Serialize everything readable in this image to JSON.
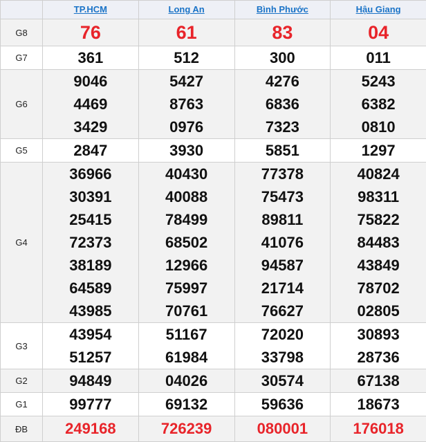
{
  "provinces": [
    "TP.HCM",
    "Long An",
    "Bình Phước",
    "Hậu Giang"
  ],
  "prizes": [
    {
      "label": "G8",
      "key": "g8",
      "style": "red",
      "results": [
        [
          "76"
        ],
        [
          "61"
        ],
        [
          "83"
        ],
        [
          "04"
        ]
      ]
    },
    {
      "label": "G7",
      "key": "g7",
      "style": "normal",
      "results": [
        [
          "361"
        ],
        [
          "512"
        ],
        [
          "300"
        ],
        [
          "011"
        ]
      ]
    },
    {
      "label": "G6",
      "key": "g6",
      "style": "normal",
      "results": [
        [
          "9046",
          "4469",
          "3429"
        ],
        [
          "5427",
          "8763",
          "0976"
        ],
        [
          "4276",
          "6836",
          "7323"
        ],
        [
          "5243",
          "6382",
          "0810"
        ]
      ]
    },
    {
      "label": "G5",
      "key": "g5",
      "style": "normal",
      "results": [
        [
          "2847"
        ],
        [
          "3930"
        ],
        [
          "5851"
        ],
        [
          "1297"
        ]
      ]
    },
    {
      "label": "G4",
      "key": "g4",
      "style": "normal",
      "results": [
        [
          "36966",
          "30391",
          "25415",
          "72373",
          "38189",
          "64589",
          "43985"
        ],
        [
          "40430",
          "40088",
          "78499",
          "68502",
          "12966",
          "75997",
          "70761"
        ],
        [
          "77378",
          "75473",
          "89811",
          "41076",
          "94587",
          "21714",
          "76627"
        ],
        [
          "40824",
          "98311",
          "75822",
          "84483",
          "43849",
          "78702",
          "02805"
        ]
      ]
    },
    {
      "label": "G3",
      "key": "g3",
      "style": "normal",
      "results": [
        [
          "43954",
          "51257"
        ],
        [
          "51167",
          "61984"
        ],
        [
          "72020",
          "33798"
        ],
        [
          "30893",
          "28736"
        ]
      ]
    },
    {
      "label": "G2",
      "key": "g2",
      "style": "normal",
      "results": [
        [
          "94849"
        ],
        [
          "04026"
        ],
        [
          "30574"
        ],
        [
          "67138"
        ]
      ]
    },
    {
      "label": "G1",
      "key": "g1",
      "style": "normal",
      "results": [
        [
          "99777"
        ],
        [
          "69132"
        ],
        [
          "59636"
        ],
        [
          "18673"
        ]
      ]
    },
    {
      "label": "ĐB",
      "key": "gdb",
      "style": "db",
      "results": [
        [
          "249168"
        ],
        [
          "726239"
        ],
        [
          "080001"
        ],
        [
          "176018"
        ]
      ]
    }
  ],
  "colors": {
    "accent_red": "#e8242a",
    "link_blue": "#1a73c7",
    "alt_row": "#f2f2f2",
    "header_bg": "#eef0f6"
  }
}
